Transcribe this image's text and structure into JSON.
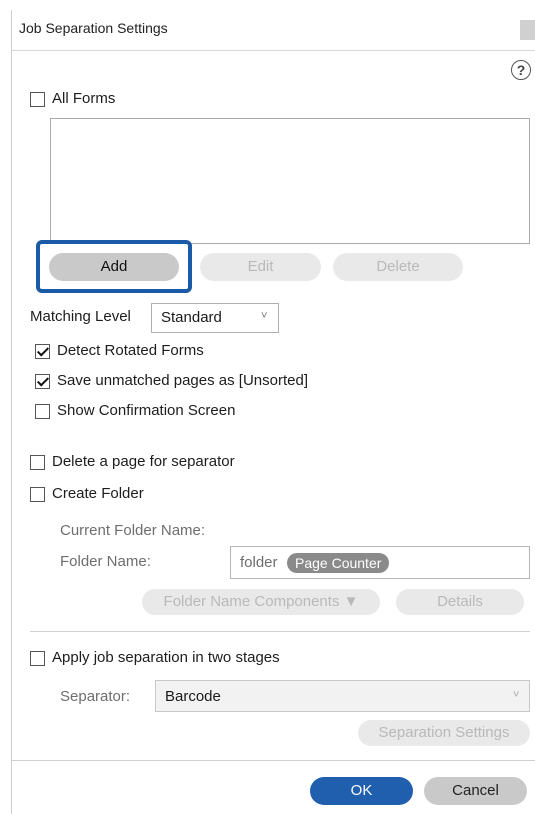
{
  "window": {
    "title": "Job Separation Settings"
  },
  "help_icon": "?",
  "all_forms": {
    "label": "All Forms",
    "checked": false
  },
  "form_buttons": {
    "add": "Add",
    "edit": "Edit",
    "delete": "Delete"
  },
  "matching_level": {
    "label": "Matching Level",
    "value": "Standard",
    "chevron": "˅"
  },
  "options": {
    "detect_rotated": {
      "label": "Detect Rotated Forms",
      "checked": true
    },
    "save_unmatched": {
      "label": "Save unmatched pages as [Unsorted]",
      "checked": true
    },
    "show_confirmation": {
      "label": "Show Confirmation Screen",
      "checked": false
    },
    "delete_page": {
      "label": "Delete a page for separator",
      "checked": false
    },
    "create_folder": {
      "label": "Create Folder",
      "checked": false
    }
  },
  "folder": {
    "current_label": "Current Folder Name:",
    "name_label": "Folder Name:",
    "name_text": "folder",
    "name_chip": "Page Counter",
    "components_button": "Folder Name Components ▼",
    "details_button": "Details"
  },
  "two_stage": {
    "label": "Apply job separation in two stages",
    "checked": false,
    "separator_label": "Separator:",
    "separator_value": "Barcode",
    "separator_chevron": "˅",
    "settings_button": "Separation Settings"
  },
  "footer": {
    "ok": "OK",
    "cancel": "Cancel"
  },
  "colors": {
    "accent": "#1f5fae",
    "highlight": "#1b5aa6"
  }
}
